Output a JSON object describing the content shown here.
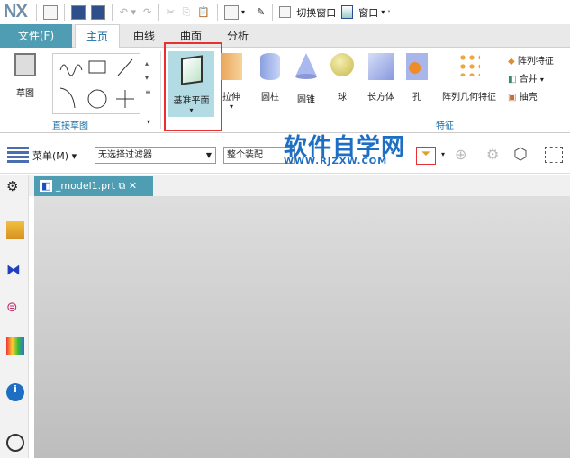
{
  "app": {
    "logo": "NX"
  },
  "quick_access": {
    "switch_window": "切换窗口",
    "window": "窗口"
  },
  "tabs": {
    "file": "文件(F)",
    "items": [
      "主页",
      "曲线",
      "曲面",
      "分析"
    ]
  },
  "ribbon": {
    "sketch": "草图",
    "group_direct_sketch": "直接草图",
    "datum_plane": "基准平面",
    "extrude": "拉伸",
    "cylinder": "圆柱",
    "cone": "圆锥",
    "sphere": "球",
    "block": "长方体",
    "hole": "孔",
    "pattern_geometry": "阵列几何特征",
    "pattern_feature": "阵列特征",
    "unite": "合并",
    "shell": "抽壳",
    "group_feature": "特征"
  },
  "selection_bar": {
    "menu": "菜单(M)",
    "filter": "无选择过滤器",
    "scope": "整个装配"
  },
  "watermark": {
    "title": "软件自学网",
    "url": "WWW.RJZXW.COM"
  },
  "document": {
    "tab": "_model1.prt"
  },
  "colors": {
    "accent": "#4e9db3",
    "highlight": "#e83030",
    "selected": "#b3dbe4"
  }
}
